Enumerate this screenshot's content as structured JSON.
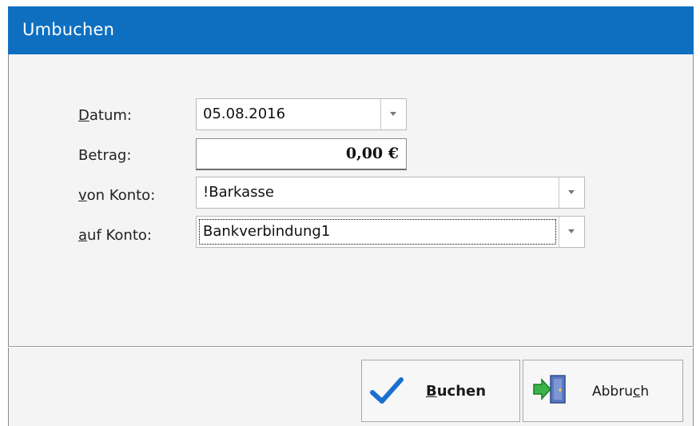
{
  "window": {
    "title": "Umbuchen"
  },
  "form": {
    "datum_label_first": "D",
    "datum_label_rest": "atum:",
    "datum_value": "05.08.2016",
    "betrag_label": "Betrag:",
    "betrag_value": "0,00 €",
    "von_label_first": "v",
    "von_label_rest": "on Konto:",
    "von_value": "!Barkasse",
    "auf_label_first": "a",
    "auf_label_rest": "uf Konto:",
    "auf_value": "Bankverbindung1"
  },
  "buttons": {
    "buchen_first": "B",
    "buchen_rest": "uchen",
    "abbruch_part1": "Abbru",
    "abbruch_ul": "c",
    "abbruch_part2": "h"
  },
  "colors": {
    "titlebar": "#0e6fc1",
    "check": "#1a6fd0"
  },
  "icons": {
    "buchen": "checkmark-icon",
    "abbruch": "exit-door-icon",
    "dropdown": "chevron-down-icon"
  }
}
